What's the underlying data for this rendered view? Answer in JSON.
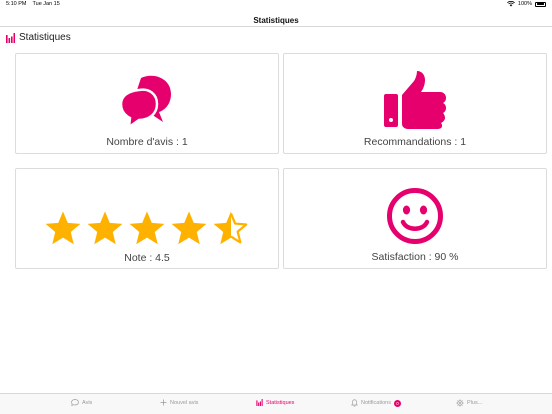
{
  "status_bar": {
    "time": "5:10 PM",
    "date": "Tue Jan 15",
    "battery": "100%"
  },
  "nav": {
    "title": "Statistiques"
  },
  "section": {
    "title": "Statistiques"
  },
  "cards": {
    "reviews": {
      "label": "Nombre d'avis : 1",
      "icon": "speech-bubbles-icon"
    },
    "recommendations": {
      "label": "Recommandations : 1",
      "icon": "thumbs-up-icon"
    },
    "rating": {
      "label": "Note : 4.5",
      "icon": "stars-rating",
      "value": 4.5,
      "max": 5
    },
    "satisfaction": {
      "label": "Satisfaction : 90 %",
      "icon": "smiley-icon"
    }
  },
  "tabs": [
    {
      "label": "Avis",
      "icon": "chat-icon"
    },
    {
      "label": "Nouvel avis",
      "icon": "plus-icon"
    },
    {
      "label": "Statistiques",
      "icon": "bar-chart-icon"
    },
    {
      "label": "Notifications",
      "icon": "bell-icon",
      "badge": "0"
    },
    {
      "label": "Plus...",
      "icon": "gear-icon"
    }
  ],
  "colors": {
    "accent": "#e6006e",
    "star": "#ffb100",
    "border": "#dcdcdc"
  }
}
